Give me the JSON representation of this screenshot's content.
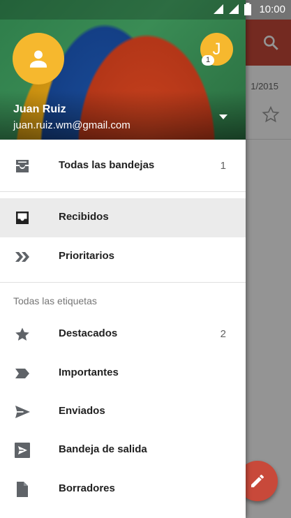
{
  "status_bar": {
    "time": "10:00"
  },
  "background_app": {
    "partial_date": "1/2015",
    "toolbar_color": "#c8493a"
  },
  "account": {
    "name": "Juan Ruiz",
    "email": "juan.ruiz.wm@gmail.com",
    "secondary_avatar_initial": "J",
    "secondary_avatar_badge": "1"
  },
  "nav": {
    "all_inboxes": {
      "label": "Todas las bandejas",
      "count": "1"
    },
    "inbox": {
      "label": "Recibidos"
    },
    "priority": {
      "label": "Prioritarios"
    },
    "section_label": "Todas las etiquetas",
    "starred": {
      "label": "Destacados",
      "count": "2"
    },
    "important": {
      "label": "Importantes"
    },
    "sent": {
      "label": "Enviados"
    },
    "outbox": {
      "label": "Bandeja de salida"
    },
    "drafts": {
      "label": "Borradores"
    }
  },
  "icons": [
    "signal-icon",
    "battery-icon",
    "search-icon",
    "star-outline-icon",
    "person-icon",
    "dropdown-arrow-icon",
    "all-inboxes-icon",
    "inbox-icon",
    "priority-icon",
    "star-icon",
    "important-icon",
    "send-icon",
    "outbox-icon",
    "draft-icon",
    "pencil-icon"
  ]
}
